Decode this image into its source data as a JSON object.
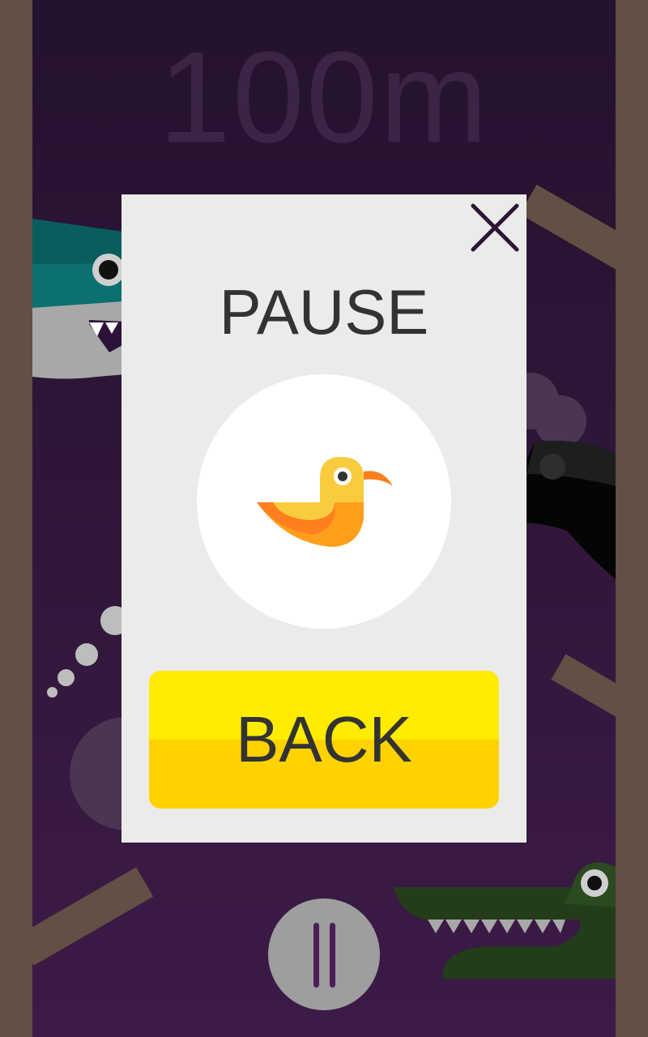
{
  "game": {
    "distance": "100m",
    "pause_dialog": {
      "title": "PAUSE",
      "back_label": "BACK",
      "close_icon": "close-icon",
      "character_icon": "duck-icon"
    },
    "hud": {
      "pause_icon": "pause-icon"
    }
  },
  "colors": {
    "background_top": "#24122e",
    "background_bottom": "#3c1b47",
    "wall": "#634f44",
    "modal": "#ebebea",
    "button_top": "#ffec00",
    "button_bottom": "#ffd200",
    "text": "#333333",
    "accent_dark": "#4a1e56"
  }
}
